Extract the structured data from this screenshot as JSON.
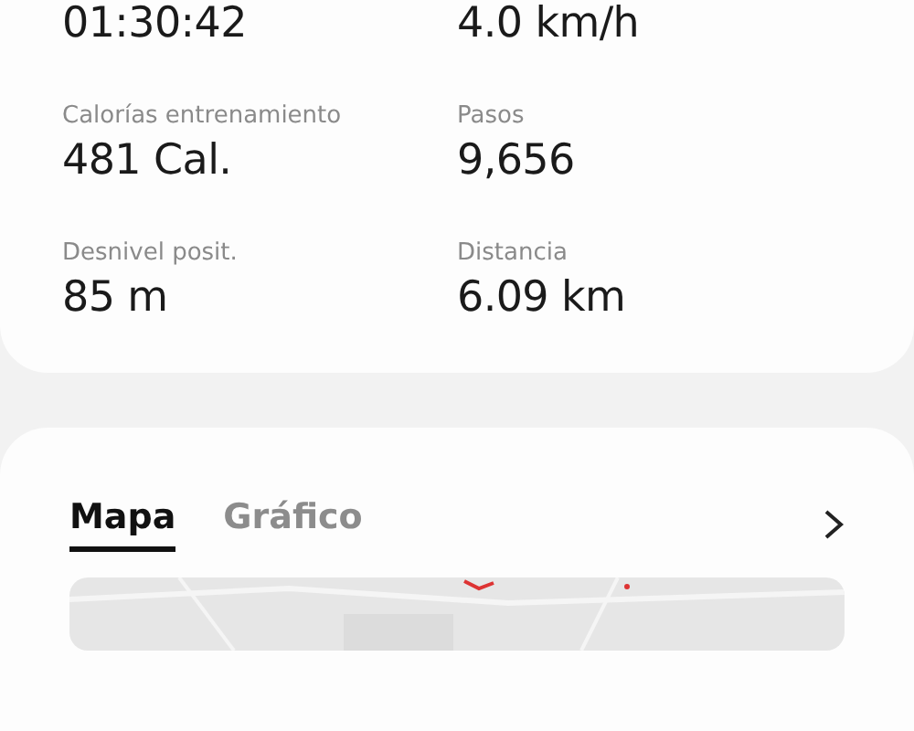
{
  "stats": [
    {
      "value": "01:30:42"
    },
    {
      "value": "4.0 km/h"
    },
    {
      "label": "Calorías entrenamiento",
      "value": "481 Cal."
    },
    {
      "label": "Pasos",
      "value": "9,656"
    },
    {
      "label": "Desnivel posit.",
      "value": "85 m"
    },
    {
      "label": "Distancia",
      "value": "6.09 km"
    }
  ],
  "tabs": [
    {
      "label": "Mapa",
      "selected": true
    },
    {
      "label": "Gráfico",
      "selected": false
    }
  ]
}
